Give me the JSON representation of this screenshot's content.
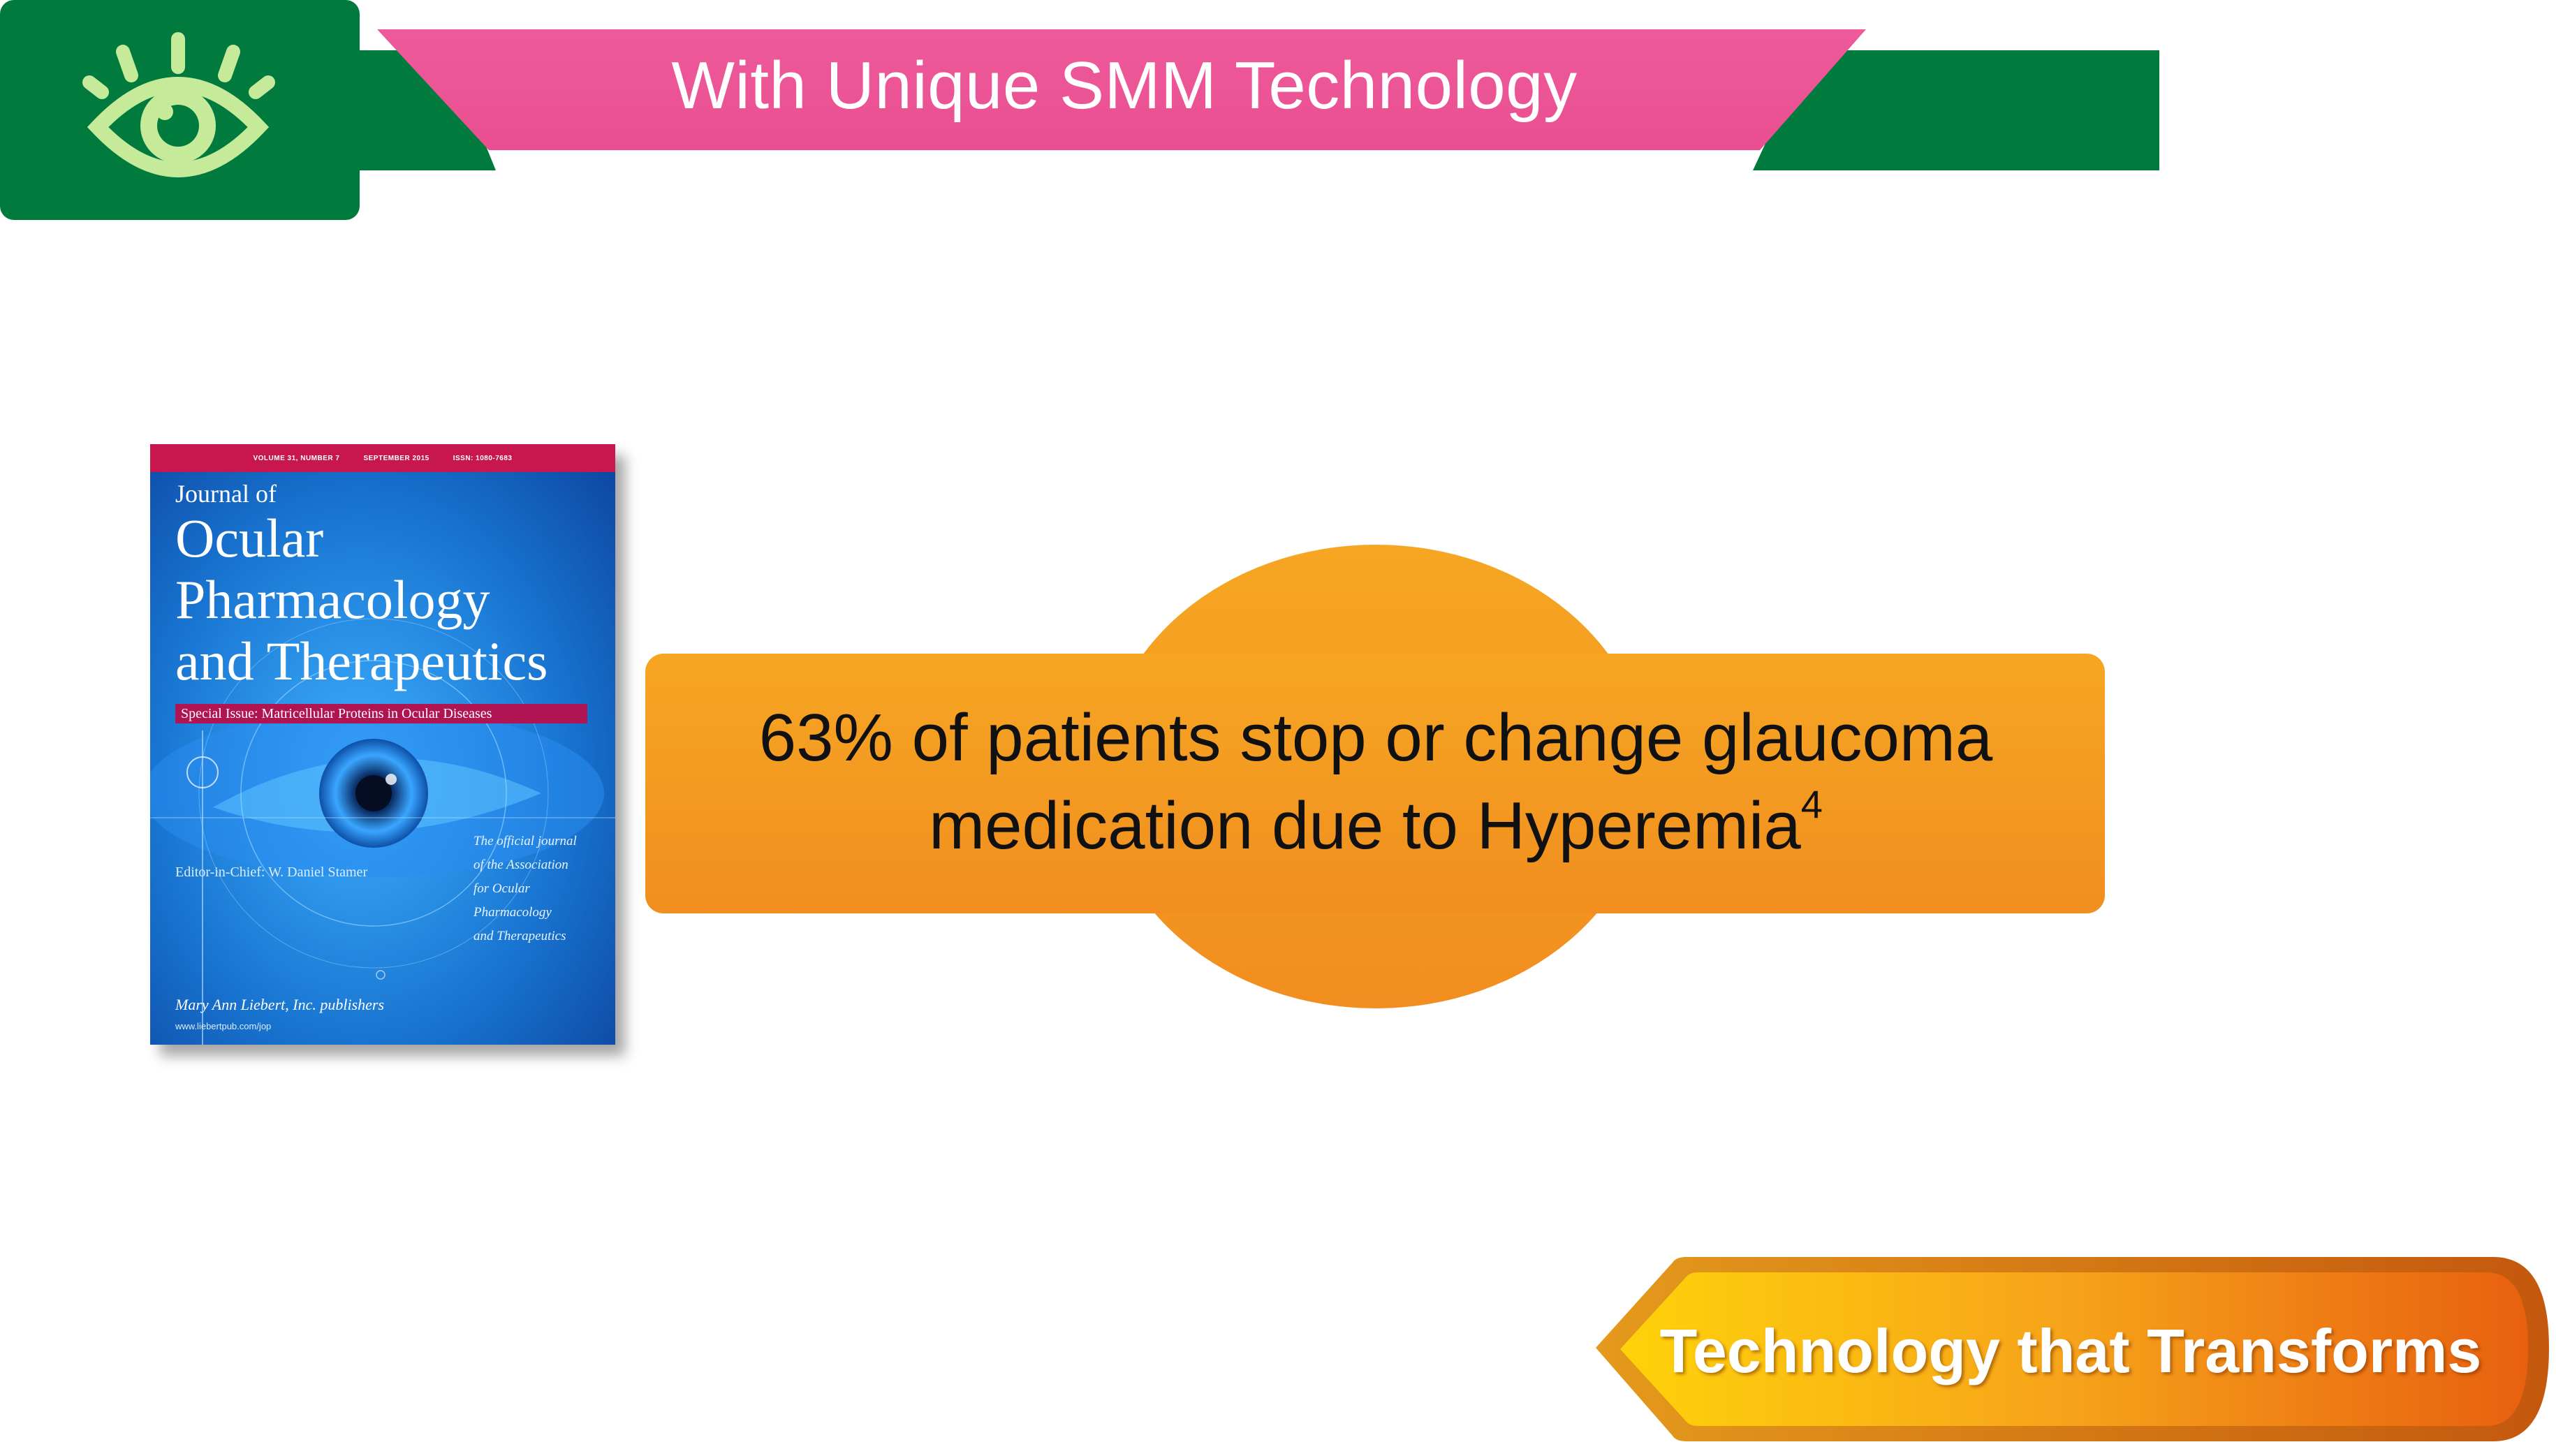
{
  "header": {
    "banner_title": "With Unique SMM Technology",
    "logo_icon": "eye-icon",
    "colors": {
      "green": "#007A3D",
      "pink": "#EC5497",
      "icon_green": "#C5EB9A"
    }
  },
  "journal_cover": {
    "meta": {
      "volume": "VOLUME 31, NUMBER 7",
      "date": "SEPTEMBER 2015",
      "issn": "ISSN: 1080-7683"
    },
    "title_line1": "Journal of",
    "title_line2": "Ocular",
    "title_line3": "Pharmacology",
    "title_line4": "and Therapeutics",
    "special_issue": "Special Issue: Matricellular Proteins in Ocular Diseases",
    "editor": "Editor-in-Chief: W. Daniel Stamer",
    "official": [
      "The official journal",
      "of the Association",
      "for Ocular",
      "Pharmacology",
      "and Therapeutics"
    ],
    "publisher": "Mary Ann Liebert, Inc. publishers",
    "url": "www.liebertpub.com/jop"
  },
  "callout": {
    "line1": "63% of patients stop or change glaucoma",
    "line2": "medication due to Hyperemia",
    "superscript": "4",
    "color": "#F4A020"
  },
  "footer_tag": {
    "label": "Technology that Transforms",
    "colors": {
      "start": "#FFD20A",
      "end": "#E8600F"
    }
  }
}
